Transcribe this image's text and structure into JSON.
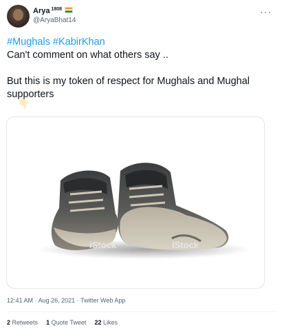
{
  "author": {
    "name": "Arya",
    "name_superscript": "1808",
    "handle": "@AryaBhat14",
    "flag_icon": "india-flag"
  },
  "tweet": {
    "hashtags": [
      "#Mughals",
      "#KabirKhan"
    ],
    "line1": "Can't comment on what others  say ..",
    "line2": "But this is my token of respect for Mughals and Mughal supporters",
    "hand_emoji": "👇"
  },
  "media": {
    "description_icon": "worn-boots-image",
    "watermark": "iStock"
  },
  "meta": {
    "time": "12:41 AM",
    "date": "Aug 26, 2021",
    "source": "Twitter Web App",
    "separator": "·"
  },
  "stats": {
    "retweets_count": "2",
    "retweets_label": "Retweets",
    "quotes_count": "1",
    "quotes_label": "Quote Tweet",
    "likes_count": "22",
    "likes_label": "Likes"
  },
  "more_icon_glyph": "···"
}
